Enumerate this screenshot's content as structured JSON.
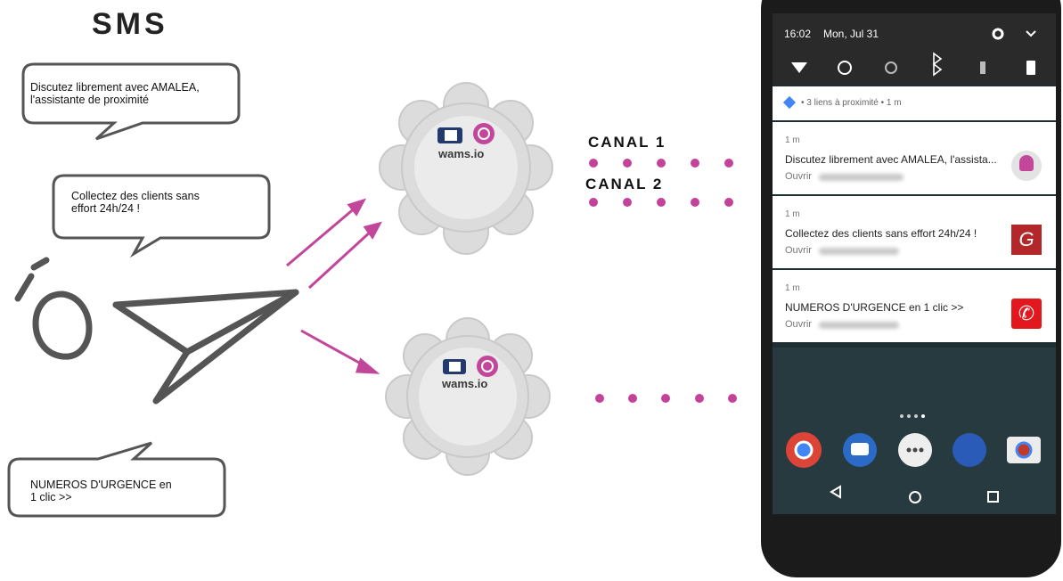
{
  "left": {
    "title": "SMS",
    "bubbles": [
      {
        "text": "Discutez librement avec AMALEA,\nl'assistante de proximité"
      },
      {
        "text": "Collectez des clients sans\neffort 24h/24 !"
      },
      {
        "text": "NUMEROS D'URGENCE en\n1 clic >>"
      }
    ]
  },
  "beacons": [
    {
      "brand": "wams.io"
    },
    {
      "brand": "wams.io"
    }
  ],
  "channels": [
    "CANAL 1",
    "CANAL 2"
  ],
  "phone": {
    "status": {
      "time": "16:02",
      "date": "Mon, Jul 31"
    },
    "nearby_header": "• 3 liens à proximité • 1 m",
    "notifications": [
      {
        "age": "1 m",
        "title": "Discutez librement avec AMALEA, l'assista...",
        "action": "Ouvrir",
        "icon": "avatar-icon"
      },
      {
        "age": "1 m",
        "title": "Collectez des clients sans effort 24h/24 !",
        "action": "Ouvrir",
        "icon": "g-logo-icon"
      },
      {
        "age": "1 m",
        "title": "NUMEROS D'URGENCE en 1 clic >>",
        "action": "Ouvrir",
        "icon": "phone-red-icon"
      }
    ]
  },
  "colors": {
    "accent": "#c2479b",
    "phone_body": "#1b1b1b",
    "dot": "#c4439a"
  }
}
